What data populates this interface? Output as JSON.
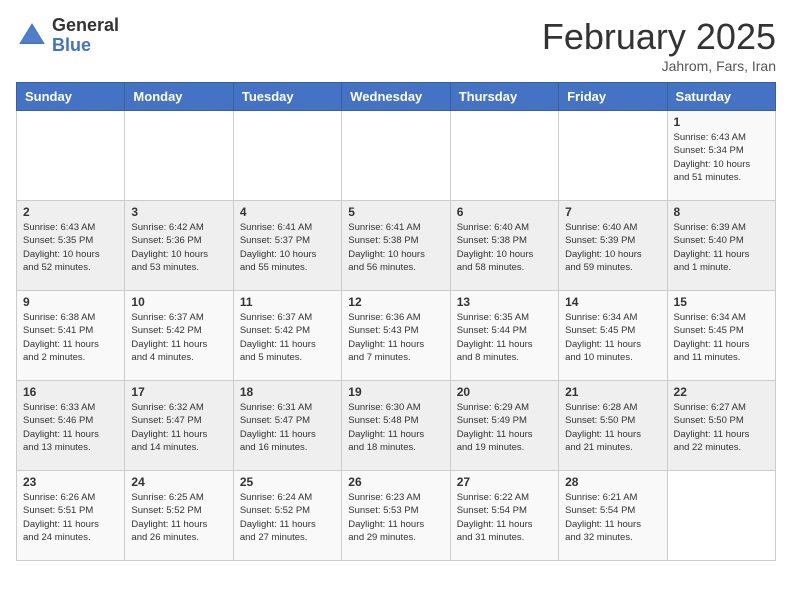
{
  "logo": {
    "general": "General",
    "blue": "Blue"
  },
  "title": "February 2025",
  "subtitle": "Jahrom, Fars, Iran",
  "days_of_week": [
    "Sunday",
    "Monday",
    "Tuesday",
    "Wednesday",
    "Thursday",
    "Friday",
    "Saturday"
  ],
  "weeks": [
    [
      {
        "day": "",
        "info": ""
      },
      {
        "day": "",
        "info": ""
      },
      {
        "day": "",
        "info": ""
      },
      {
        "day": "",
        "info": ""
      },
      {
        "day": "",
        "info": ""
      },
      {
        "day": "",
        "info": ""
      },
      {
        "day": "1",
        "info": "Sunrise: 6:43 AM\nSunset: 5:34 PM\nDaylight: 10 hours\nand 51 minutes."
      }
    ],
    [
      {
        "day": "2",
        "info": "Sunrise: 6:43 AM\nSunset: 5:35 PM\nDaylight: 10 hours\nand 52 minutes."
      },
      {
        "day": "3",
        "info": "Sunrise: 6:42 AM\nSunset: 5:36 PM\nDaylight: 10 hours\nand 53 minutes."
      },
      {
        "day": "4",
        "info": "Sunrise: 6:41 AM\nSunset: 5:37 PM\nDaylight: 10 hours\nand 55 minutes."
      },
      {
        "day": "5",
        "info": "Sunrise: 6:41 AM\nSunset: 5:38 PM\nDaylight: 10 hours\nand 56 minutes."
      },
      {
        "day": "6",
        "info": "Sunrise: 6:40 AM\nSunset: 5:38 PM\nDaylight: 10 hours\nand 58 minutes."
      },
      {
        "day": "7",
        "info": "Sunrise: 6:40 AM\nSunset: 5:39 PM\nDaylight: 10 hours\nand 59 minutes."
      },
      {
        "day": "8",
        "info": "Sunrise: 6:39 AM\nSunset: 5:40 PM\nDaylight: 11 hours\nand 1 minute."
      }
    ],
    [
      {
        "day": "9",
        "info": "Sunrise: 6:38 AM\nSunset: 5:41 PM\nDaylight: 11 hours\nand 2 minutes."
      },
      {
        "day": "10",
        "info": "Sunrise: 6:37 AM\nSunset: 5:42 PM\nDaylight: 11 hours\nand 4 minutes."
      },
      {
        "day": "11",
        "info": "Sunrise: 6:37 AM\nSunset: 5:42 PM\nDaylight: 11 hours\nand 5 minutes."
      },
      {
        "day": "12",
        "info": "Sunrise: 6:36 AM\nSunset: 5:43 PM\nDaylight: 11 hours\nand 7 minutes."
      },
      {
        "day": "13",
        "info": "Sunrise: 6:35 AM\nSunset: 5:44 PM\nDaylight: 11 hours\nand 8 minutes."
      },
      {
        "day": "14",
        "info": "Sunrise: 6:34 AM\nSunset: 5:45 PM\nDaylight: 11 hours\nand 10 minutes."
      },
      {
        "day": "15",
        "info": "Sunrise: 6:34 AM\nSunset: 5:45 PM\nDaylight: 11 hours\nand 11 minutes."
      }
    ],
    [
      {
        "day": "16",
        "info": "Sunrise: 6:33 AM\nSunset: 5:46 PM\nDaylight: 11 hours\nand 13 minutes."
      },
      {
        "day": "17",
        "info": "Sunrise: 6:32 AM\nSunset: 5:47 PM\nDaylight: 11 hours\nand 14 minutes."
      },
      {
        "day": "18",
        "info": "Sunrise: 6:31 AM\nSunset: 5:47 PM\nDaylight: 11 hours\nand 16 minutes."
      },
      {
        "day": "19",
        "info": "Sunrise: 6:30 AM\nSunset: 5:48 PM\nDaylight: 11 hours\nand 18 minutes."
      },
      {
        "day": "20",
        "info": "Sunrise: 6:29 AM\nSunset: 5:49 PM\nDaylight: 11 hours\nand 19 minutes."
      },
      {
        "day": "21",
        "info": "Sunrise: 6:28 AM\nSunset: 5:50 PM\nDaylight: 11 hours\nand 21 minutes."
      },
      {
        "day": "22",
        "info": "Sunrise: 6:27 AM\nSunset: 5:50 PM\nDaylight: 11 hours\nand 22 minutes."
      }
    ],
    [
      {
        "day": "23",
        "info": "Sunrise: 6:26 AM\nSunset: 5:51 PM\nDaylight: 11 hours\nand 24 minutes."
      },
      {
        "day": "24",
        "info": "Sunrise: 6:25 AM\nSunset: 5:52 PM\nDaylight: 11 hours\nand 26 minutes."
      },
      {
        "day": "25",
        "info": "Sunrise: 6:24 AM\nSunset: 5:52 PM\nDaylight: 11 hours\nand 27 minutes."
      },
      {
        "day": "26",
        "info": "Sunrise: 6:23 AM\nSunset: 5:53 PM\nDaylight: 11 hours\nand 29 minutes."
      },
      {
        "day": "27",
        "info": "Sunrise: 6:22 AM\nSunset: 5:54 PM\nDaylight: 11 hours\nand 31 minutes."
      },
      {
        "day": "28",
        "info": "Sunrise: 6:21 AM\nSunset: 5:54 PM\nDaylight: 11 hours\nand 32 minutes."
      },
      {
        "day": "",
        "info": ""
      }
    ]
  ]
}
